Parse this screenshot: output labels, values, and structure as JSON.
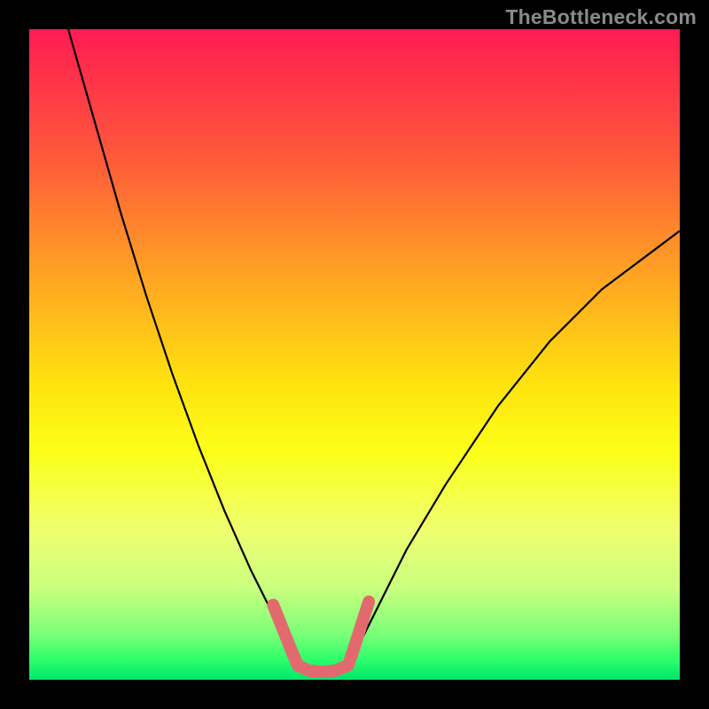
{
  "watermark": "TheBottleneck.com",
  "chart_data": {
    "type": "line",
    "title": "",
    "xlabel": "",
    "ylabel": "",
    "xlim": [
      0,
      1
    ],
    "ylim": [
      0,
      1
    ],
    "series": [
      {
        "name": "left-curve",
        "x": [
          0.06,
          0.1,
          0.14,
          0.18,
          0.22,
          0.26,
          0.3,
          0.34,
          0.36,
          0.38,
          0.4,
          0.41
        ],
        "y": [
          1.0,
          0.86,
          0.72,
          0.59,
          0.47,
          0.36,
          0.26,
          0.17,
          0.13,
          0.09,
          0.05,
          0.02
        ]
      },
      {
        "name": "right-curve",
        "x": [
          0.49,
          0.51,
          0.54,
          0.58,
          0.64,
          0.72,
          0.8,
          0.88,
          0.96,
          1.0
        ],
        "y": [
          0.02,
          0.06,
          0.12,
          0.2,
          0.3,
          0.42,
          0.52,
          0.6,
          0.66,
          0.69
        ]
      },
      {
        "name": "valley-floor",
        "x": [
          0.41,
          0.43,
          0.45,
          0.47,
          0.49
        ],
        "y": [
          0.02,
          0.012,
          0.01,
          0.012,
          0.02
        ]
      },
      {
        "name": "pink-overlay-left",
        "x": [
          0.375,
          0.385,
          0.395,
          0.405,
          0.413
        ],
        "y": [
          0.115,
          0.09,
          0.065,
          0.04,
          0.022
        ]
      },
      {
        "name": "pink-overlay-floor",
        "x": [
          0.413,
          0.43,
          0.45,
          0.47,
          0.49
        ],
        "y": [
          0.022,
          0.014,
          0.012,
          0.014,
          0.022
        ]
      },
      {
        "name": "pink-overlay-right",
        "x": [
          0.49,
          0.498,
          0.506,
          0.514,
          0.522
        ],
        "y": [
          0.022,
          0.045,
          0.07,
          0.095,
          0.12
        ]
      }
    ],
    "colors": {
      "curve": "#000000",
      "overlay": "#e26a6f",
      "bg_top": "#ff1c52",
      "bg_bottom": "#00e56a"
    }
  }
}
